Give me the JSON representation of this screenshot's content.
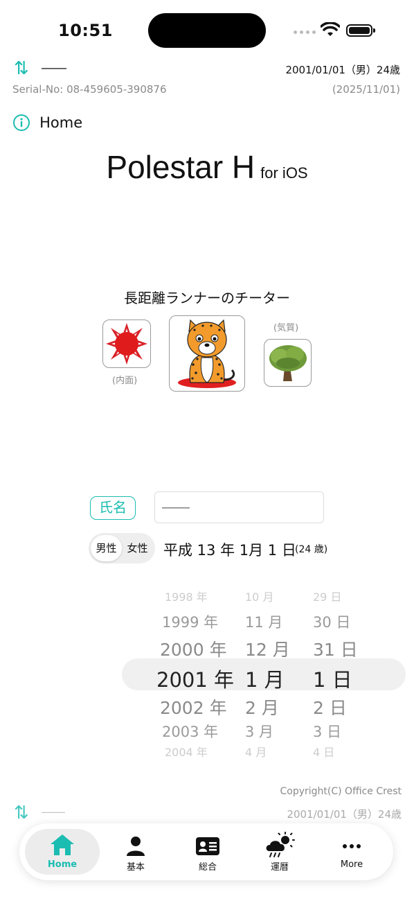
{
  "status": {
    "time": "10:51"
  },
  "header": {
    "name": "――",
    "birth": "2001/01/01（男）24歳",
    "serial": "Serial-No: 08-459605-390876",
    "date": "(2025/11/01)",
    "home_label": "Home"
  },
  "app_title": {
    "main": "Polestar H",
    "sub": "for iOS"
  },
  "animal": {
    "title": "長距離ランナーのチーター",
    "inner_caption": "(内面)",
    "temperament_caption": "(気質)"
  },
  "form": {
    "name_label": "氏名",
    "name_placeholder": "――",
    "male": "男性",
    "female": "女性",
    "era_date": "平成 13 年 1月 1 日",
    "age": "(24 歳)"
  },
  "picker": {
    "years": [
      "1998 年",
      "1999 年",
      "2000 年",
      "2001 年",
      "2002 年",
      "2003 年",
      "2004 年"
    ],
    "months": [
      "10 月",
      "11 月",
      "12 月",
      "1 月",
      "2 月",
      "3 月",
      "4 月"
    ],
    "days": [
      "29 日",
      "30 日",
      "31 日",
      "1 日",
      "2 日",
      "3 日",
      "4 日"
    ]
  },
  "footer": {
    "copyright": "Copyright(C) Office Crest",
    "name": "――",
    "birth": "2001/01/01（男）24歳"
  },
  "tabs": [
    {
      "label": "Home",
      "icon": "home-icon",
      "active": true
    },
    {
      "label": "基本",
      "icon": "person-icon",
      "active": false
    },
    {
      "label": "総合",
      "icon": "id-card-icon",
      "active": false
    },
    {
      "label": "運暦",
      "icon": "weather-icon",
      "active": false
    },
    {
      "label": "More",
      "icon": "more-icon",
      "active": false
    }
  ],
  "colors": {
    "accent": "#1bbcb1",
    "muted": "#8a8a8a"
  }
}
